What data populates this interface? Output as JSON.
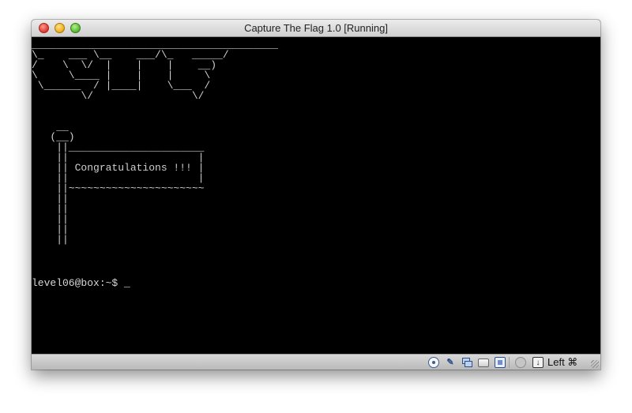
{
  "window": {
    "title": "Capture The Flag 1.0 [Running]"
  },
  "terminal": {
    "art": "________________________________________\n\\_    ___ \\__    ___/\\_   _____/\n/    \\  \\/  |    |    |    __)\n\\     \\____ |    |    |     \\\n \\______  / |____|    \\___  /\n        \\/                \\/\n\n\n    __\n   (__)\n    ||______________________\n    ||                     |\n    || Congratulations !!! |\n    ||                     |\n    ||~~~~~~~~~~~~~~~~~~~~~~\n    ||\n    ||\n    ||\n    ||\n    ||",
    "prompt": "level06@box:~$ ",
    "cursor": "_"
  },
  "statusbar": {
    "icons": [
      "cd-icon",
      "usb-icon",
      "network-icon",
      "shared-folder-icon",
      "video-memory-icon",
      "virtualization-icon",
      "mouse-integration-icon"
    ],
    "host_key": "Left ⌘"
  }
}
